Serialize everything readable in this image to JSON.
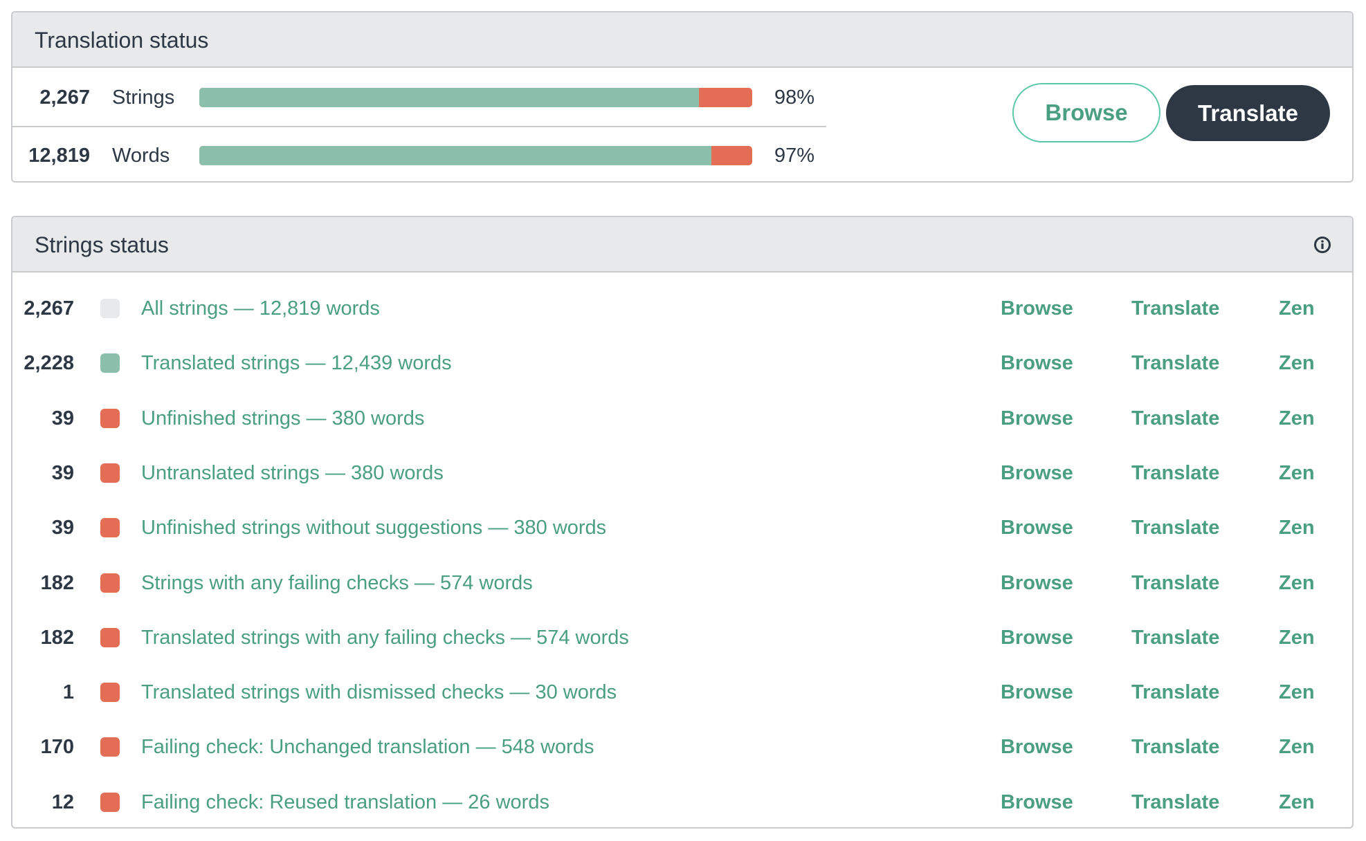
{
  "translation_status": {
    "title": "Translation status",
    "rows": [
      {
        "count": "2,267",
        "label": "Strings",
        "percent_label": "98%",
        "translated_fraction": 0.904
      },
      {
        "count": "12,819",
        "label": "Words",
        "percent_label": "97%",
        "translated_fraction": 0.926
      }
    ],
    "browse_label": "Browse",
    "translate_label": "Translate",
    "colors": {
      "translated": "#8cbeac",
      "untranslated": "#e46e55"
    }
  },
  "strings_status": {
    "title": "Strings status",
    "info_icon": "info-circle-icon",
    "actions": {
      "browse": "Browse",
      "translate": "Translate",
      "zen": "Zen"
    },
    "rows": [
      {
        "count": "2,267",
        "label": "All strings — 12,819 words",
        "color": "#e8e9eb"
      },
      {
        "count": "2,228",
        "label": "Translated strings — 12,439 words",
        "color": "#8cbeac"
      },
      {
        "count": "39",
        "label": "Unfinished strings — 380 words",
        "color": "#e46e55"
      },
      {
        "count": "39",
        "label": "Untranslated strings — 380 words",
        "color": "#e46e55"
      },
      {
        "count": "39",
        "label": "Unfinished strings without suggestions — 380 words",
        "color": "#e46e55"
      },
      {
        "count": "182",
        "label": "Strings with any failing checks — 574 words",
        "color": "#e46e55"
      },
      {
        "count": "182",
        "label": "Translated strings with any failing checks — 574 words",
        "color": "#e46e55"
      },
      {
        "count": "1",
        "label": "Translated strings with dismissed checks — 30 words",
        "color": "#e46e55"
      },
      {
        "count": "170",
        "label": "Failing check: Unchanged translation — 548 words",
        "color": "#e46e55"
      },
      {
        "count": "12",
        "label": "Failing check: Reused translation — 26 words",
        "color": "#e46e55"
      }
    ]
  }
}
